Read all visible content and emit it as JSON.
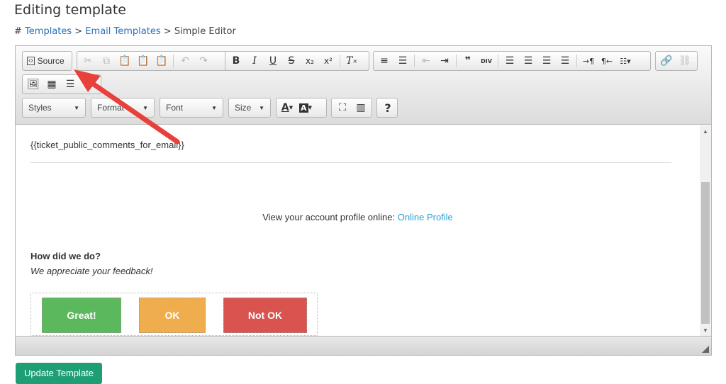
{
  "page": {
    "title": "Editing template",
    "breadcrumb": {
      "prefix": "#",
      "templates": "Templates",
      "sep1": ">",
      "email_templates": "Email Templates",
      "sep2": ">",
      "current": "Simple Editor"
    }
  },
  "toolbar": {
    "source_label": "Source",
    "styles_label": "Styles",
    "format_label": "Format",
    "font_label": "Font",
    "size_label": "Size",
    "help_label": "?",
    "subscript_label": "x₂",
    "superscript_label": "x²",
    "div_label": "DIV"
  },
  "content": {
    "variable": "{{ticket_public_comments_for_email}}",
    "profile_text": "View your account profile online:",
    "profile_link": "Online Profile",
    "how_heading": "How did we do?",
    "appreciate": "We appreciate your feedback!",
    "rating_buttons": [
      "Great!",
      "OK",
      "Not OK"
    ]
  },
  "actions": {
    "update_label": "Update Template"
  },
  "colors": {
    "great": "#5cb85c",
    "ok": "#f0ad4e",
    "not_ok": "#d9534f",
    "update": "#1d9e74",
    "link": "#2aa0d8",
    "annotation_arrow": "#e8403a"
  }
}
